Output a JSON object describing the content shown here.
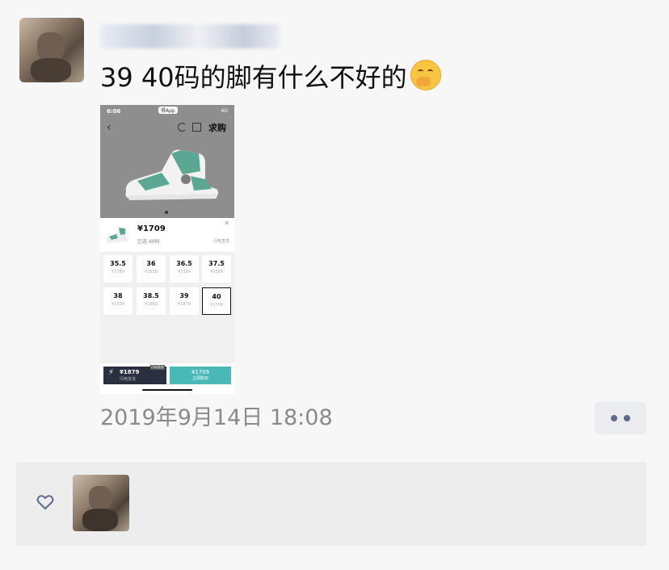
{
  "post": {
    "username": "",
    "text": "39 40码的脚有什么不好的",
    "emoji": "face-with-hand-over-mouth-icon",
    "timestamp": "2019年9月14日 18:08"
  },
  "embedded_screenshot": {
    "status_time": "6:06",
    "app_pill": "得App",
    "signal": "4G",
    "buy_label": "求购",
    "product_price": "¥1709",
    "chosen_label": "已选 40码",
    "mini_link": "闪电直发",
    "sizes": [
      {
        "size": "35.5",
        "price": "¥2789"
      },
      {
        "size": "36",
        "price": "¥2539"
      },
      {
        "size": "36.5",
        "price": "¥2309"
      },
      {
        "size": "37.5",
        "price": "¥2589"
      },
      {
        "size": "38",
        "price": "¥2309"
      },
      {
        "size": "38.5",
        "price": "¥1869"
      },
      {
        "size": "39",
        "price": "¥1879"
      },
      {
        "size": "40",
        "price": "¥1709"
      }
    ],
    "selected_size": "40",
    "btn_dark_price": "¥1879",
    "btn_dark_tag": "闪电直发",
    "btn_dark_sub": "闪电发货",
    "btn_teal_price": "¥1709",
    "btn_teal_sub": "立即购买"
  },
  "colors": {
    "accent_teal": "#4bb8b8",
    "dark_button": "#2b3040",
    "more_dots": "#5d6b8a",
    "timestamp_gray": "#8a8a8a"
  },
  "icons": {
    "like": "heart-icon",
    "more": "more-dots-icon"
  }
}
